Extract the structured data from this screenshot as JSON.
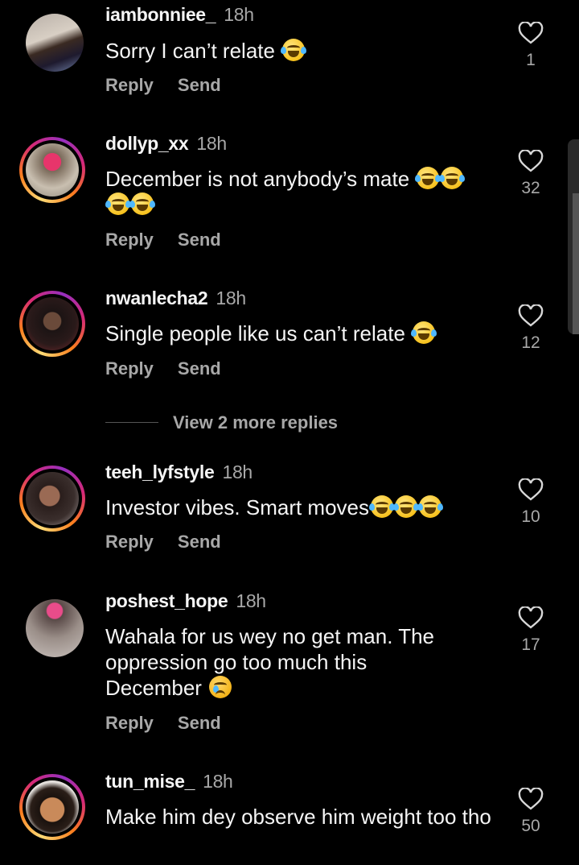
{
  "actions": {
    "reply": "Reply",
    "send": "Send"
  },
  "view_more": "View 2 more replies",
  "comments": [
    {
      "username": "iambonniee_",
      "time": "18h",
      "text": "Sorry I can’t relate",
      "emojis": [
        "laugh"
      ],
      "likes": "1",
      "story_ring": false
    },
    {
      "username": "dollyp_xx",
      "time": "18h",
      "text": "December is not anybody’s mate",
      "emojis": [
        "laugh",
        "laugh",
        "laugh",
        "laugh"
      ],
      "likes": "32",
      "story_ring": true
    },
    {
      "username": "nwanlecha2",
      "time": "18h",
      "text": "Single people like us can’t relate",
      "emojis": [
        "laugh"
      ],
      "likes": "12",
      "story_ring": true
    },
    {
      "username": "teeh_lyfstyle",
      "time": "18h",
      "text": "Investor vibes. Smart moves",
      "emojis": [
        "laugh",
        "laugh",
        "laugh"
      ],
      "likes": "10",
      "story_ring": true
    },
    {
      "username": "poshest_hope",
      "time": "18h",
      "text": "Wahala for us wey no get man. The oppression go too much this December",
      "emojis": [
        "cry"
      ],
      "likes": "17",
      "story_ring": false
    },
    {
      "username": "tun_mise_",
      "time": "18h",
      "text": "Make him dey observe him weight too tho",
      "emojis": [],
      "likes": "50",
      "story_ring": true
    }
  ],
  "colors": {
    "background": "#000000",
    "text": "#f5f5f5",
    "muted": "#a8a8a8"
  }
}
